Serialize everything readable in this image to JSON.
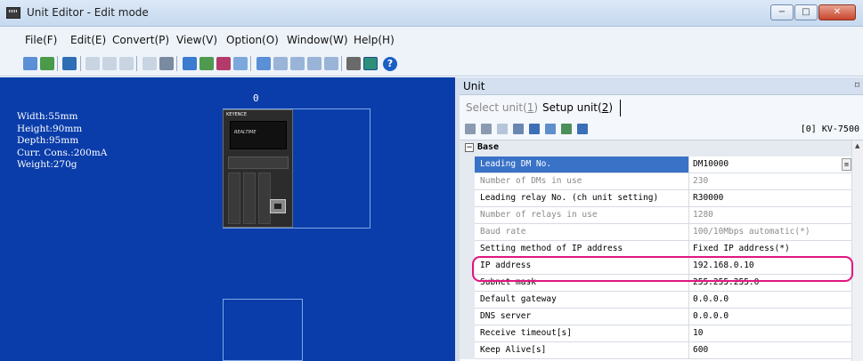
{
  "window": {
    "title": "Unit Editor - Edit mode",
    "min_label": "−",
    "max_label": "□",
    "close_label": "✕"
  },
  "menu": [
    "File(F)",
    "Edit(E)",
    "Convert(P)",
    "View(V)",
    "Option(O)",
    "Window(W)",
    "Help(H)"
  ],
  "toolbar": {
    "icons": [
      "import-icon",
      "export-icon",
      "transfer-icon",
      "cut-icon",
      "copy-icon",
      "paste-icon",
      "edit-icon",
      "unit-icon",
      "monitor-icon",
      "check-icon",
      "settings-icon",
      "module-icon",
      "module-icon",
      "module-icon",
      "module-icon",
      "module-icon",
      "tool-icon",
      "window-icon",
      "help-icon"
    ],
    "help_label": "?"
  },
  "canvas": {
    "slot_label": "0",
    "info": [
      "Width:55mm",
      "Height:90mm",
      "Depth:95mm",
      "Curr. Cons.:200mA",
      "Weight:270g"
    ],
    "plc_brand": "KEYENCE",
    "plc_display": "REALTIME"
  },
  "unit_panel": {
    "title": "Unit",
    "pin_icon": "⌑",
    "tabs": [
      {
        "label": "Select unit(",
        "key": "1",
        "suffix": ")"
      },
      {
        "label": "Setup unit(",
        "key": "2",
        "suffix": ")"
      }
    ],
    "unit_id": "[0] KV-7500",
    "category": "Base",
    "rows": [
      {
        "name": "Leading DM No.",
        "value": "DM10000",
        "state": "selected"
      },
      {
        "name": "Number of DMs in use",
        "value": "230",
        "state": "disabled"
      },
      {
        "name": "Leading relay No. (ch unit setting)",
        "value": "R30000",
        "state": "normal"
      },
      {
        "name": "Number of relays in use",
        "value": "1280",
        "state": "disabled"
      },
      {
        "name": "Baud rate",
        "value": "100/10Mbps automatic(*)",
        "state": "disabled"
      },
      {
        "name": "Setting method of IP address",
        "value": "Fixed IP address(*)",
        "state": "normal"
      },
      {
        "name": "IP address",
        "value": "192.168.0.10",
        "state": "normal"
      },
      {
        "name": "Subnet mask",
        "value": "255.255.255.0",
        "state": "normal"
      },
      {
        "name": "Default gateway",
        "value": "0.0.0.0",
        "state": "normal"
      },
      {
        "name": "DNS server",
        "value": "0.0.0.0",
        "state": "normal"
      },
      {
        "name": "Receive timeout[s]",
        "value": "10",
        "state": "normal"
      },
      {
        "name": "Keep Alive[s]",
        "value": "600",
        "state": "normal"
      }
    ]
  },
  "colors": {
    "canvas_bg": "#0a3daa",
    "selection": "#3a72c8",
    "highlight": "#e0157f"
  }
}
